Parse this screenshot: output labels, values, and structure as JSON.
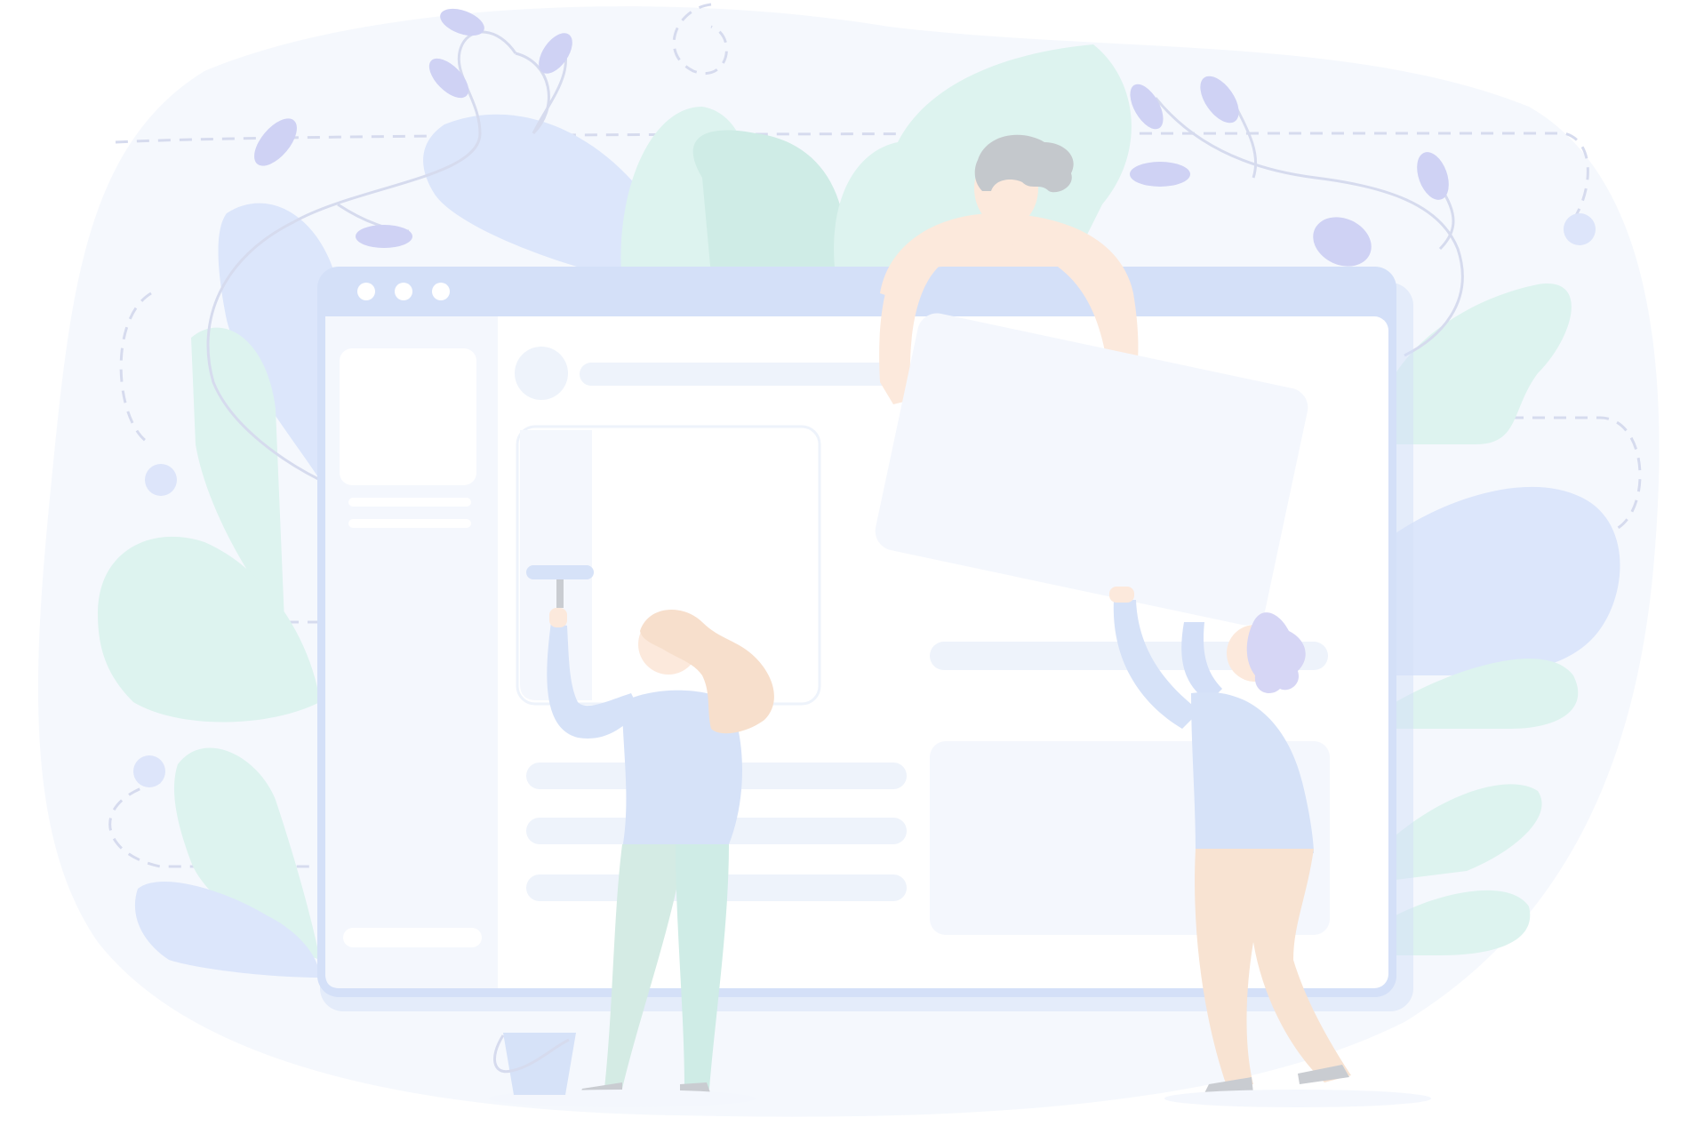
{
  "illustration": {
    "theme": "website-construction-team",
    "colors": {
      "backdrop": "#f5f8fd",
      "leaf_blue": "#dce6fb",
      "leaf_mint": "#ddf3ef",
      "leaf_mint_dark": "#cfece6",
      "vine": "#d6dbee",
      "bud": "#cfd2f4",
      "dot": "#dde5fa",
      "window_frame": "#d4e0f8",
      "window_body": "#ffffff",
      "sidebar": "#f4f7fd",
      "placeholder": "#eef3fb",
      "panel": "#f4f7fd",
      "skin": "#fce9dc",
      "hair_gray": "#c4c8cc",
      "hair_peach": "#f7dfcc",
      "hair_purple": "#d6d6f5",
      "shirt_blue": "#d6e2f8",
      "pants_mint": "#d4ebe4",
      "pants_peach": "#f8e3d2",
      "shoe": "#c9ccd1",
      "bucket": "#d6e2f8"
    },
    "icons": [
      "window-dots-icon",
      "paint-roller-icon",
      "paint-bucket-icon"
    ]
  }
}
